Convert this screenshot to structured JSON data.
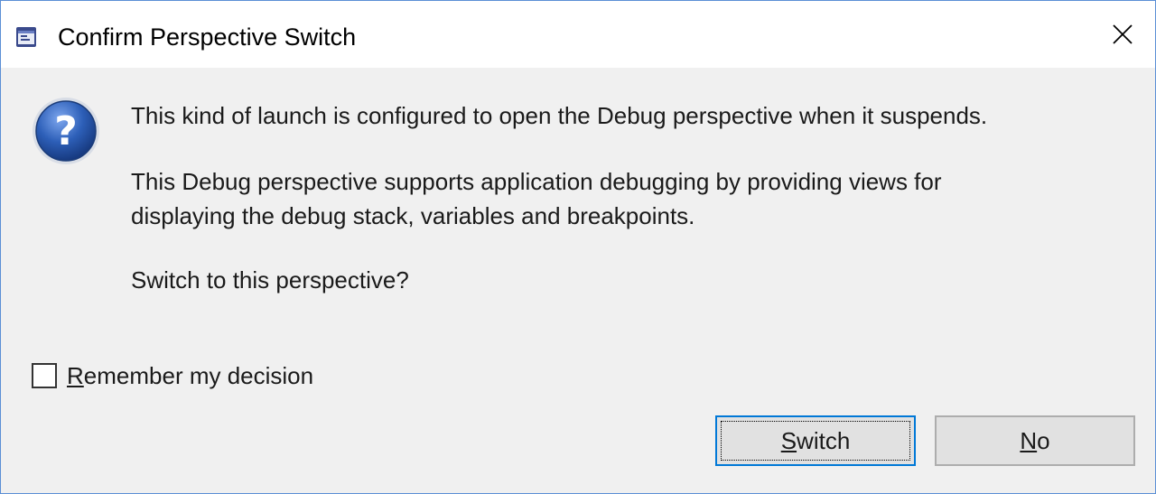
{
  "window": {
    "title": "Confirm Perspective Switch"
  },
  "message": {
    "line1": "This kind of launch is configured to open the Debug perspective when it suspends.",
    "line2a": "This Debug perspective supports application debugging by providing views for",
    "line2b": "displaying the debug stack, variables and breakpoints.",
    "line3": "Switch to this perspective?"
  },
  "remember": {
    "label_mnemonic": "R",
    "label_rest": "emember my decision",
    "checked": false
  },
  "buttons": {
    "switch": {
      "mnemonic": "S",
      "rest": "witch",
      "default": true
    },
    "no": {
      "mnemonic": "N",
      "rest": "o",
      "default": false
    }
  },
  "icons": {
    "app": "eclipse-app-icon",
    "question": "question-icon",
    "close": "close-icon"
  },
  "colors": {
    "window_border": "#5b8fd6",
    "dialog_bg": "#f0f0f0",
    "default_button_border": "#0078d7",
    "question_icon_blue": "#2d5fb8"
  }
}
